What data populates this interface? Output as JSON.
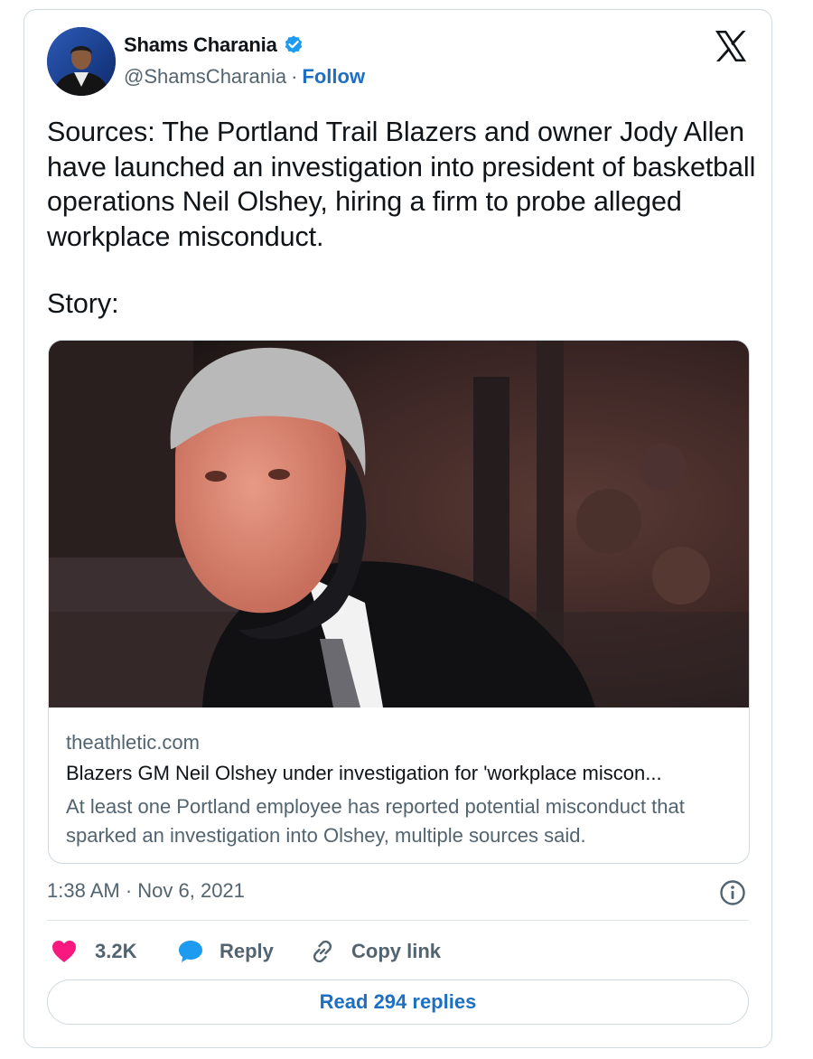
{
  "author": {
    "name": "Shams Charania",
    "handle": "@ShamsCharania",
    "separator": "·",
    "follow_label": "Follow",
    "verified_color": "#1d9bf0"
  },
  "platform_logo": "x-logo-icon",
  "tweet": {
    "text": "Sources: The Portland Trail Blazers and owner Jody Allen have launched an investigation into president of basketball operations Neil Olshey, hiring a firm to probe alleged workplace misconduct.",
    "story_label": "Story:"
  },
  "link_card": {
    "domain": "theathletic.com",
    "title": "Blazers GM Neil Olshey under investigation for 'workplace miscon...",
    "description": "At least one Portland employee has reported potential misconduct that sparked an investigation into Olshey, multiple sources said."
  },
  "timestamp": "1:38 AM · Nov 6, 2021",
  "actions": {
    "like_count": "3.2K",
    "reply_label": "Reply",
    "copy_link_label": "Copy link"
  },
  "read_replies_label": "Read 294 replies",
  "colors": {
    "accent": "#1d6fc4",
    "like": "#f91880",
    "reply": "#1d9bf0",
    "secondary_text": "#536471",
    "border": "#cfd9de"
  }
}
